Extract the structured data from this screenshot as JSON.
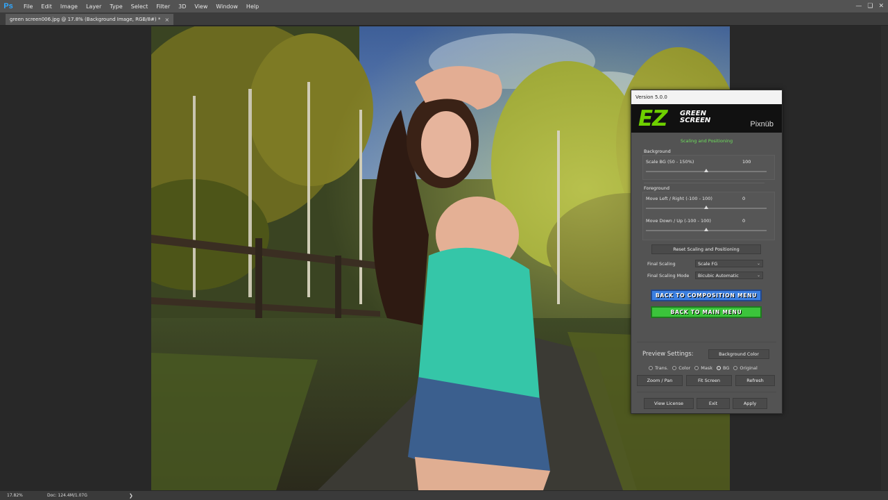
{
  "menubar": {
    "app_icon": "Ps",
    "items": [
      "File",
      "Edit",
      "Image",
      "Layer",
      "Type",
      "Select",
      "Filter",
      "3D",
      "View",
      "Window",
      "Help"
    ]
  },
  "document": {
    "tab_title": "green screen006.jpg @ 17.8% (Background Image, RGB/8#) *",
    "close_glyph": "×"
  },
  "statusbar": {
    "zoom": "17.82%",
    "doc_info": "Doc: 124.4M/1.07G",
    "arrow": "❯"
  },
  "panel": {
    "version": "Version 5.0.0",
    "logo_main": "EZ",
    "logo_sub_line1": "GREEN",
    "logo_sub_line2": "SCREEN",
    "brand": "Pixnüb",
    "section_title": "Scaling and Positioning",
    "background": {
      "label": "Background",
      "scale_label": "Scale BG (50 - 150%)",
      "scale_value": "100",
      "scale_level": 0.5
    },
    "foreground": {
      "label": "Foreground",
      "move_lr_label": "Move Left / Right (-100 - 100)",
      "move_lr_value": "0",
      "move_lr_level": 0.5,
      "move_du_label": "Move Down / Up (-100 - 100)",
      "move_du_value": "0",
      "move_du_level": 0.5
    },
    "reset_button": "Reset Scaling and Positioning",
    "final_scaling_label": "Final Scaling",
    "final_scaling_value": "Scale FG",
    "final_mode_label": "Final Scaling Mode",
    "final_mode_value": "Bicubic Automatic",
    "back_composition": "BACK TO COMPOSITION MENU",
    "back_main": "BACK TO MAIN MENU",
    "preview_label": "Preview Settings:",
    "bg_color_button": "Background Color",
    "preview_options": [
      {
        "label": "Trans.",
        "checked": false
      },
      {
        "label": "Color",
        "checked": false
      },
      {
        "label": "Mask",
        "checked": false
      },
      {
        "label": "BG",
        "checked": true
      },
      {
        "label": "Original",
        "checked": false
      }
    ],
    "zoom_pan": "Zoom / Pan",
    "fit_screen": "Fit Screen",
    "refresh": "Refresh",
    "view_license": "View License",
    "exit": "Exit",
    "apply": "Apply"
  },
  "colors": {
    "ez_green": "#6ed000",
    "section_green": "#6ee05c",
    "blue_button": "#3b7fe0",
    "green_button": "#3bc43b",
    "top_color": "#35c6a8"
  }
}
